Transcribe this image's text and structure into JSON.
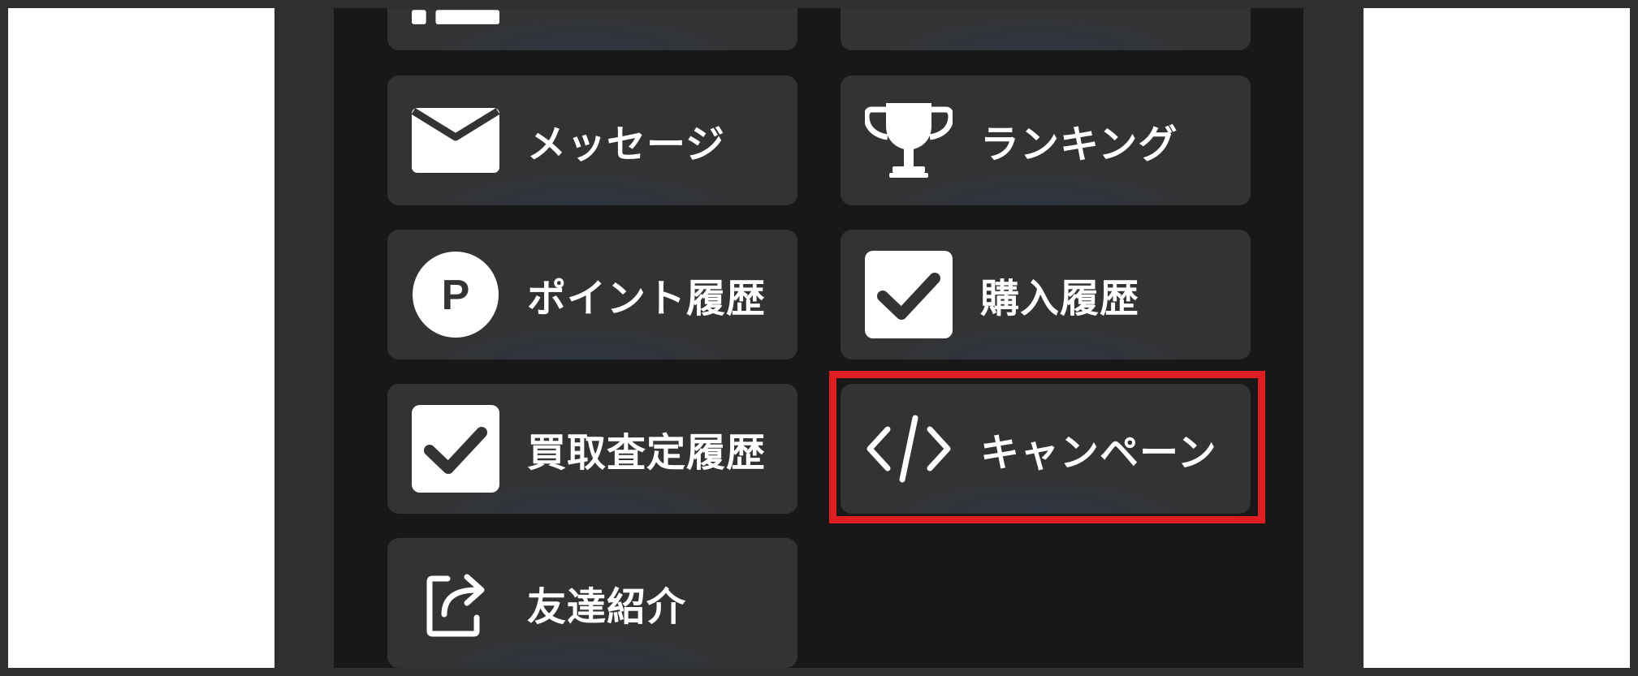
{
  "menu": {
    "items": [
      {
        "id": "message",
        "label": "メッセージ",
        "icon": "envelope-icon"
      },
      {
        "id": "ranking",
        "label": "ランキング",
        "icon": "trophy-icon"
      },
      {
        "id": "point-history",
        "label": "ポイント履歴",
        "icon": "point-circle-icon",
        "icon_glyph": "P"
      },
      {
        "id": "purchase-history",
        "label": "購入履歴",
        "icon": "checkbox-checked-icon"
      },
      {
        "id": "appraisal-history",
        "label": "買取査定履歴",
        "icon": "checkbox-checked-icon"
      },
      {
        "id": "campaign",
        "label": "キャンペーン",
        "icon": "code-icon",
        "highlighted": true
      },
      {
        "id": "referral",
        "label": "友達紹介",
        "icon": "share-icon"
      }
    ]
  },
  "colors": {
    "page_background": "#2f2f2f",
    "app_background": "#181818",
    "card_background": "#333333",
    "text": "#ffffff",
    "highlight": "#e01e22"
  }
}
